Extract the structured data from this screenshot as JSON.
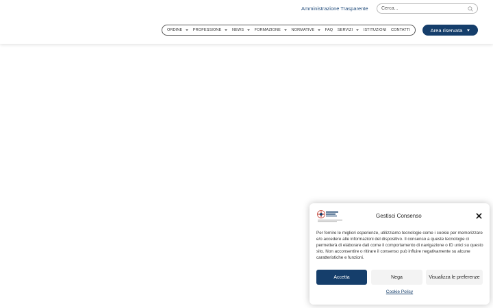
{
  "header": {
    "top_link": "Amministrazione Trasparente",
    "search_placeholder": "Cerca...",
    "nav_items": [
      {
        "label": "ORDINE",
        "has_dropdown": true
      },
      {
        "label": "PROFESSIONE",
        "has_dropdown": true
      },
      {
        "label": "NEWS",
        "has_dropdown": true
      },
      {
        "label": "FORMAZIONE",
        "has_dropdown": true
      },
      {
        "label": "NORMATIVE",
        "has_dropdown": true
      },
      {
        "label": "FAQ",
        "has_dropdown": false
      },
      {
        "label": "SERVIZI",
        "has_dropdown": true
      },
      {
        "label": "ISTITUZIONI",
        "has_dropdown": false
      },
      {
        "label": "CONTATTI",
        "has_dropdown": false
      }
    ],
    "area_button": "Area riservata"
  },
  "consent": {
    "title": "Gestisci Consenso",
    "text": "Per fornire le migliori esperienze, utilizziamo tecnologie come i cookie per memorizzare e/o accedere alle informazioni del dispositivo. Il consenso a queste tecnologie ci permetterà di elaborare dati come il comportamento di navigazione o ID unici su questo sito. Non acconsentire o ritirare il consenso può influire negativamente su alcune caratteristiche e funzioni.",
    "accept_label": "Accetta",
    "deny_label": "Nega",
    "prefs_label": "Visualizza le preferenze",
    "policy_link": "Cookie Policy"
  },
  "colors": {
    "brand_blue": "#153e6b",
    "link_blue": "#1f4a7a"
  }
}
